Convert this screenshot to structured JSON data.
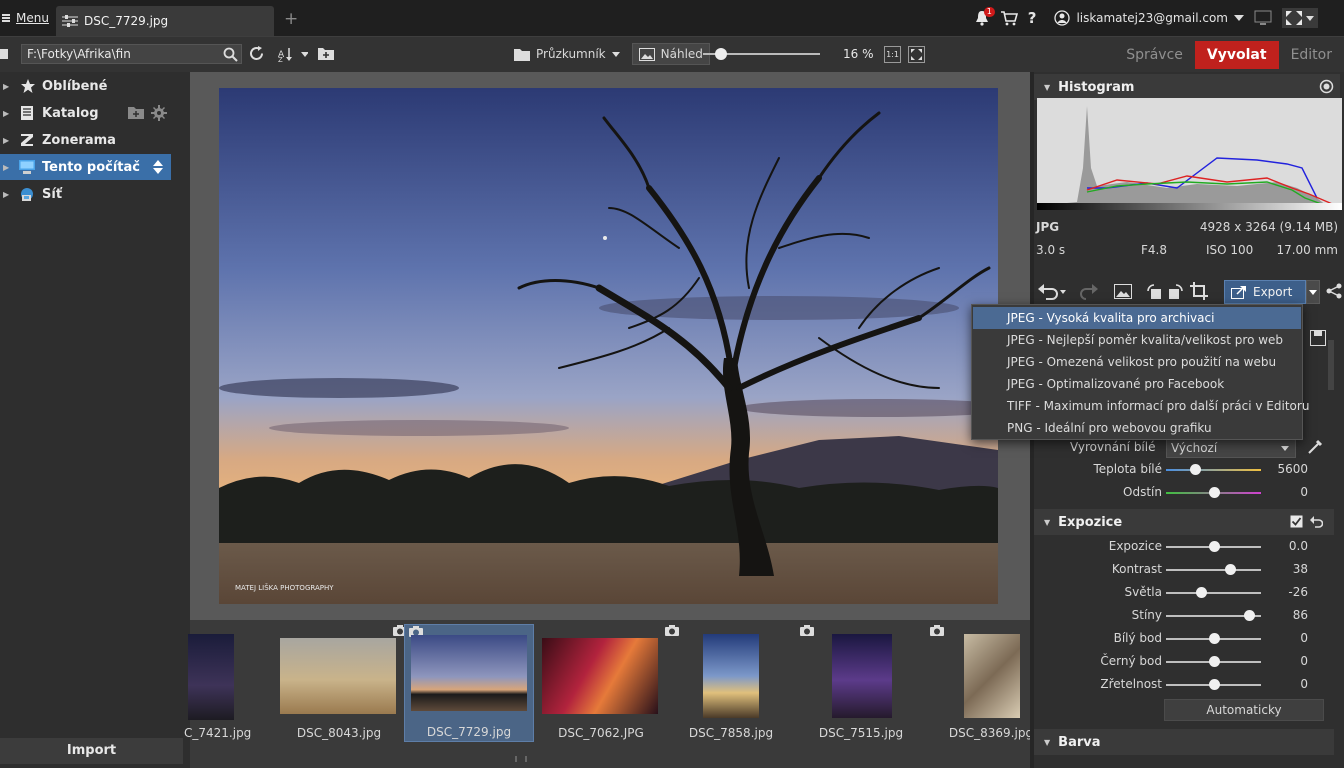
{
  "topbar": {
    "menu_label": "Menu",
    "doc_tab_title": "DSC_7729.jpg",
    "new_tab": "+",
    "notification_count": "1",
    "user_email": "liskamatej23@gmail.com"
  },
  "toolbar": {
    "path_value": "F:\\Fotky\\Afrika\\fin",
    "explorer_label": "Průzkumník",
    "preview_label": "Náhled",
    "zoom_percent": "16 %",
    "zoom_fraction": 0.15,
    "fit_label": "1:1",
    "modes": {
      "manager": "Správce",
      "develop": "Vyvolat",
      "editor": "Editor"
    }
  },
  "left_panel": {
    "items": [
      {
        "label": "Oblíbené",
        "icon": "star-icon"
      },
      {
        "label": "Katalog",
        "icon": "catalog-icon"
      },
      {
        "label": "Zonerama",
        "icon": "zonerama-icon"
      },
      {
        "label": "Tento počítač",
        "icon": "computer-icon",
        "active": true
      },
      {
        "label": "Síť",
        "icon": "network-icon"
      }
    ],
    "import_label": "Import"
  },
  "photo": {
    "watermark": "MATEJ LIŠKA PHOTOGRAPHY"
  },
  "filmstrip": {
    "thumbs": [
      {
        "caption": "C_7421.jpg"
      },
      {
        "caption": "DSC_8043.jpg"
      },
      {
        "caption": "DSC_7729.jpg",
        "selected": true
      },
      {
        "caption": "DSC_7062.JPG"
      },
      {
        "caption": "DSC_7858.jpg"
      },
      {
        "caption": "DSC_7515.jpg"
      },
      {
        "caption": "DSC_8369.jpg"
      }
    ]
  },
  "right_panel": {
    "histogram_title": "Histogram",
    "format": "JPG",
    "dimensions": "4928 x 3264 (9.14 MB)",
    "exposure_time": "3.0 s",
    "aperture": "F4.8",
    "iso": "ISO 100",
    "focal": "17.00 mm",
    "export_label": "Export",
    "white_balance": {
      "label": "Vyrovnání bílé",
      "value": "Výchozí",
      "temperature_label": "Teplota bílé",
      "temperature_value": "5600",
      "temperature_fraction": 0.3,
      "tint_label": "Odstín",
      "tint_value": "0",
      "tint_fraction": 0.5
    },
    "exposure_section": {
      "title": "Expozice",
      "sliders": [
        {
          "label": "Expozice",
          "value": "0.0",
          "fraction": 0.5
        },
        {
          "label": "Kontrast",
          "value": "38",
          "fraction": 0.67
        },
        {
          "label": "Světla",
          "value": "-26",
          "fraction": 0.37
        },
        {
          "label": "Stíny",
          "value": "86",
          "fraction": 0.87
        },
        {
          "label": "Bílý bod",
          "value": "0",
          "fraction": 0.5
        },
        {
          "label": "Černý bod",
          "value": "0",
          "fraction": 0.5
        },
        {
          "label": "Zřetelnost",
          "value": "0",
          "fraction": 0.5
        }
      ],
      "auto_label": "Automaticky"
    },
    "color_section_title": "Barva"
  },
  "export_menu": {
    "items": [
      "JPEG - Vysoká kvalita pro archivaci",
      "JPEG - Nejlepší poměr kvalita/velikost pro web",
      "JPEG - Omezená velikost pro použití na webu",
      "JPEG - Optimalizované pro Facebook",
      "TIFF - Maximum informací pro další práci v Editoru",
      "PNG - Ideální pro webovou grafiku"
    ]
  },
  "colors": {
    "accent_red": "#c0211d",
    "selection_blue": "#3a6fa8"
  }
}
